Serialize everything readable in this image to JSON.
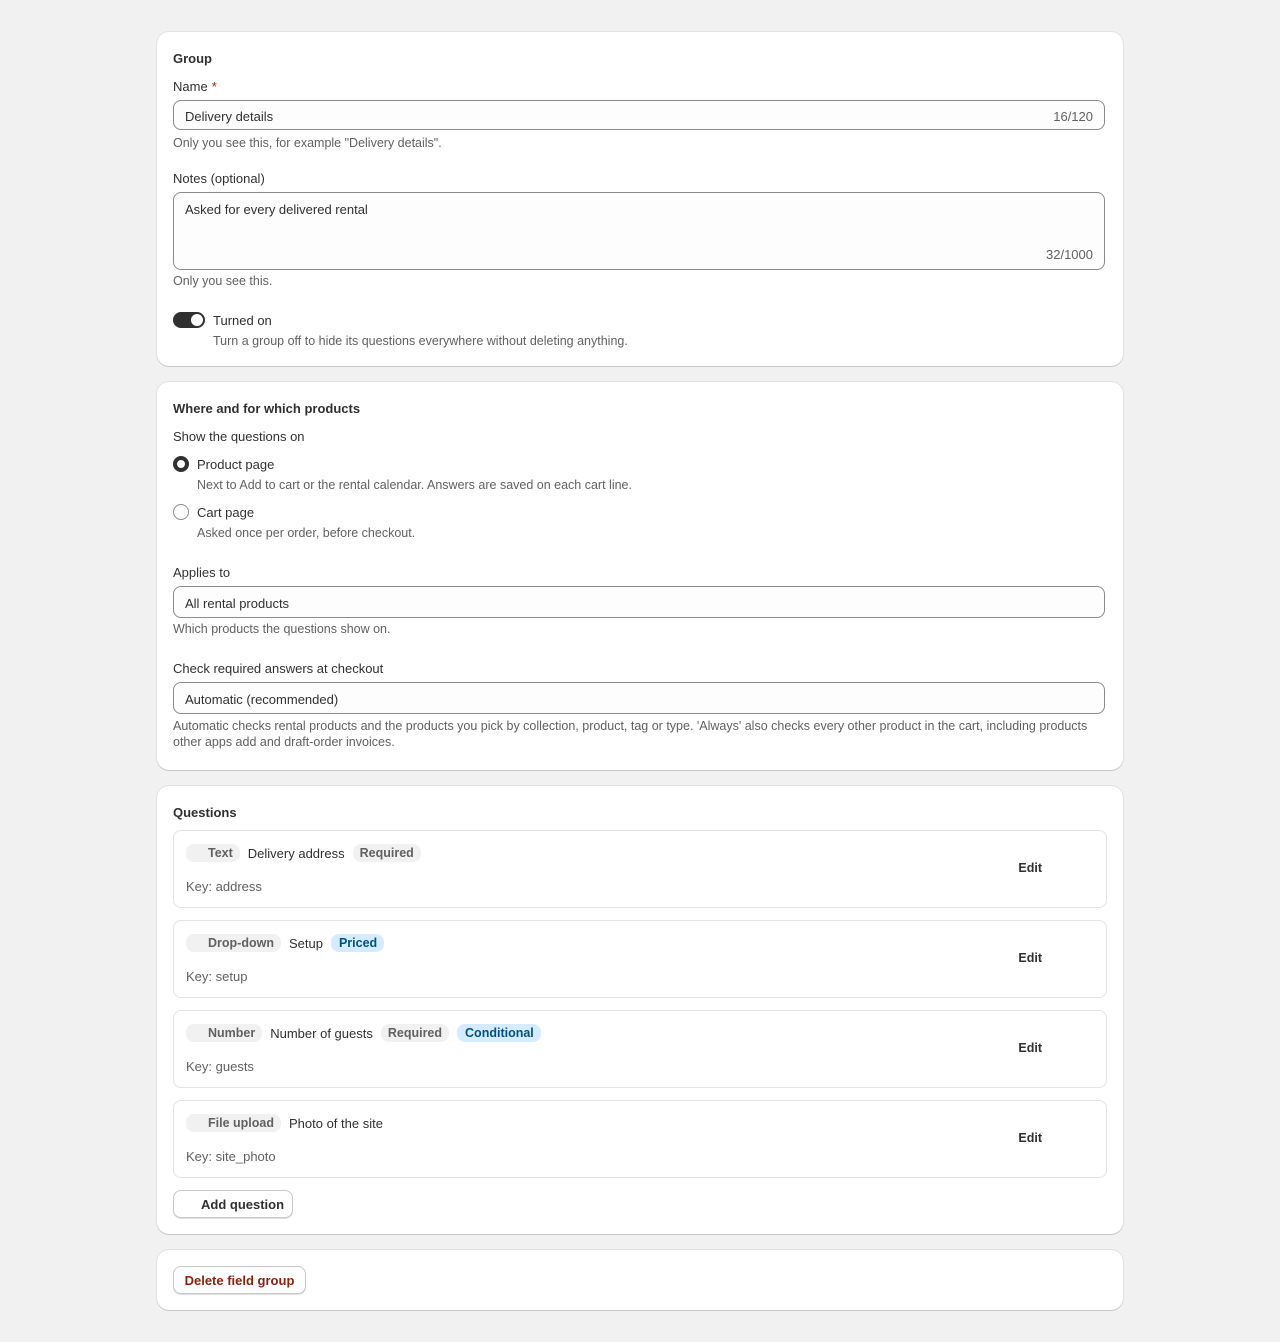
{
  "group": {
    "heading": "Group",
    "name_label": "Name",
    "required_mark": "*",
    "name_value": "Delivery details",
    "name_count": "16/120",
    "name_help": "Only you see this, for example \"Delivery details\".",
    "notes_label": "Notes (optional)",
    "notes_value": "Asked for every delivered rental",
    "notes_count": "32/1000",
    "notes_help": "Only you see this.",
    "toggle_label": "Turned on",
    "toggle_help": "Turn a group off to hide its questions everywhere without deleting anything.",
    "toggle_on": true
  },
  "where": {
    "heading": "Where and for which products",
    "show_label": "Show the questions on",
    "options": [
      {
        "label": "Product page",
        "help": "Next to Add to cart or the rental calendar. Answers are saved on each cart line.",
        "selected": true
      },
      {
        "label": "Cart page",
        "help": "Asked once per order, before checkout.",
        "selected": false
      }
    ],
    "applies_label": "Applies to",
    "applies_value": "All rental products",
    "applies_help": "Which products the questions show on.",
    "check_label": "Check required answers at checkout",
    "check_value": "Automatic (recommended)",
    "check_help": "Automatic checks rental products and the products you pick by collection, product, tag or type. 'Always' also checks every other product in the cart, including products other apps add and draft-order invoices."
  },
  "questions": {
    "heading": "Questions",
    "edit_label": "Edit",
    "items": [
      {
        "type": "Text",
        "title": "Delivery address",
        "badges": [
          "Required"
        ],
        "blue_badges": [],
        "key": "Key: address"
      },
      {
        "type": "Drop-down",
        "title": "Setup",
        "badges": [],
        "blue_badges": [
          "Priced"
        ],
        "key": "Key: setup"
      },
      {
        "type": "Number",
        "title": "Number of guests",
        "badges": [
          "Required"
        ],
        "blue_badges": [
          "Conditional"
        ],
        "key": "Key: guests"
      },
      {
        "type": "File upload",
        "title": "Photo of the site",
        "badges": [],
        "blue_badges": [],
        "key": "Key: site_photo"
      }
    ],
    "add_label": "Add question"
  },
  "danger": {
    "delete_label": "Delete field group"
  },
  "colors": {
    "page_bg": "#f1f1f1",
    "card_bg": "#ffffff",
    "text": "#303030",
    "subdued": "#616161",
    "critical": "#8e1f0b",
    "info_bg": "#d5ebff",
    "info_text": "#00527c"
  }
}
